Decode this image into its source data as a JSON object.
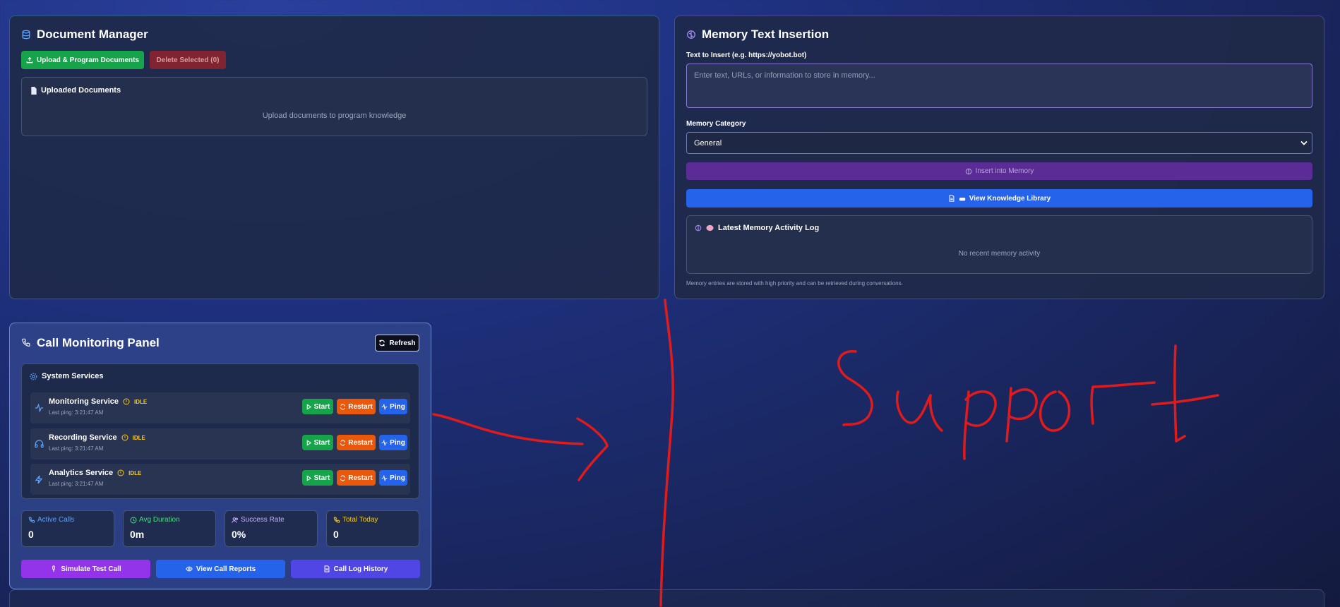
{
  "document_manager": {
    "title": "Document Manager",
    "upload_button": "Upload & Program Documents",
    "delete_button": "Delete Selected (0)",
    "uploaded_title": "Uploaded Documents",
    "empty_text": "Upload documents to program knowledge"
  },
  "memory": {
    "title": "Memory Text Insertion",
    "text_label": "Text to Insert (e.g. https://yobot.bot)",
    "text_placeholder": "Enter text, URLs, or information to store in memory...",
    "category_label": "Memory Category",
    "category_value": "General",
    "insert_button": "Insert into Memory",
    "library_button": "View Knowledge Library",
    "log_title": "Latest Memory Activity Log",
    "log_empty": "No recent memory activity",
    "footnote": "Memory entries are stored with high priority and can be retrieved during conversations."
  },
  "call_panel": {
    "title": "Call Monitoring Panel",
    "refresh_button": "Refresh",
    "services_title": "System Services",
    "services": [
      {
        "name": "Monitoring Service",
        "status": "IDLE",
        "last_ping": "Last ping: 3:21:47 AM",
        "icon": "activity-icon"
      },
      {
        "name": "Recording Service",
        "status": "IDLE",
        "last_ping": "Last ping: 3:21:47 AM",
        "icon": "headphones-icon"
      },
      {
        "name": "Analytics Service",
        "status": "IDLE",
        "last_ping": "Last ping: 3:21:47 AM",
        "icon": "zap-icon"
      }
    ],
    "service_buttons": {
      "start": "Start",
      "restart": "Restart",
      "ping": "Ping"
    },
    "stats": [
      {
        "label": "Active Calls",
        "value": "0",
        "color": "#60a5fa"
      },
      {
        "label": "Avg Duration",
        "value": "0m",
        "color": "#4ade80"
      },
      {
        "label": "Success Rate",
        "value": "0%",
        "color": "#c4b5fd"
      },
      {
        "label": "Total Today",
        "value": "0",
        "color": "#facc15"
      }
    ],
    "actions": {
      "simulate": "Simulate Test Call",
      "reports": "View Call Reports",
      "history": "Call Log History"
    }
  },
  "annotation": {
    "text": "Support",
    "color": "#e01b1b"
  },
  "colors": {
    "green": "#16a34a",
    "red_disabled": "#7f2430",
    "purple": "#5b2b96",
    "blue": "#2563eb",
    "orange": "#ea580c",
    "violet": "#9333ea"
  }
}
